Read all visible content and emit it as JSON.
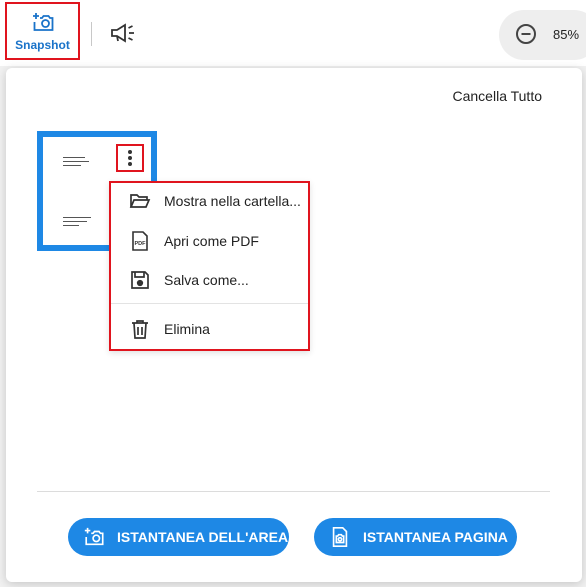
{
  "toolbar": {
    "snapshot_label": "Snapshot",
    "zoom_value": "85%",
    "icons": [
      "camera-plus-icon",
      "megaphone-icon",
      "zoom-out-icon"
    ]
  },
  "panel": {
    "clear_all_label": "Cancella Tutto",
    "context_menu": {
      "items": [
        {
          "label": "Mostra nella cartella...",
          "icon": "folder-open-icon"
        },
        {
          "label": "Apri come PDF",
          "icon": "pdf-file-icon"
        },
        {
          "label": "Salva come...",
          "icon": "save-icon"
        },
        {
          "label": "Elimina",
          "icon": "trash-icon"
        }
      ]
    },
    "thumbnail_icon": "kebab-menu-icon",
    "buttons": {
      "area_label": "ISTANTANEA DELL'AREA",
      "page_label": "ISTANTANEA PAGINA"
    }
  },
  "colors": {
    "accent": "#1e88e5",
    "highlight_border": "#e0141e",
    "snapshot_text": "#1a73c9"
  }
}
